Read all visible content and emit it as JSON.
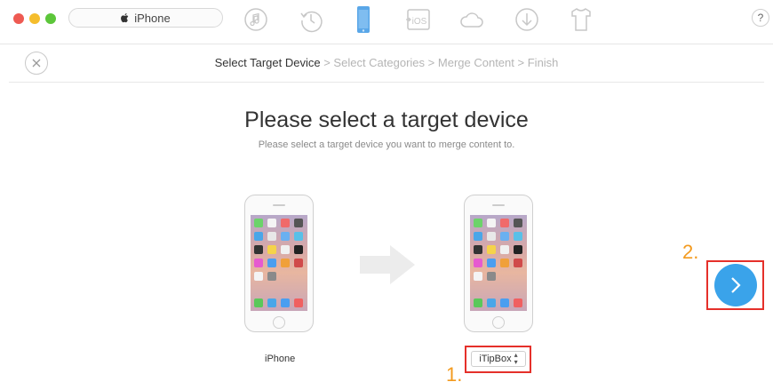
{
  "window": {
    "device_name": "iPhone",
    "help_label": "?"
  },
  "toolbar": {
    "icons": [
      "music-icon",
      "backup-history-icon",
      "iphone-icon",
      "ios-update-icon",
      "icloud-icon",
      "download-icon",
      "shirt-icon"
    ],
    "active_icon": "iphone-icon"
  },
  "steps": {
    "items": [
      "Select Target Device",
      "Select Categories",
      "Merge Content",
      "Finish"
    ],
    "separator": ">",
    "active_index": 0
  },
  "main": {
    "title": "Please select a target device",
    "subtitle": "Please select a target device you want to merge content to.",
    "source_device_label": "iPhone",
    "target_device_value": "iTipBox"
  },
  "annotations": {
    "step1": "1.",
    "step2": "2."
  },
  "colors": {
    "accent": "#3aa3ea",
    "highlight": "#e5302a",
    "annotation": "#f39a1e"
  }
}
